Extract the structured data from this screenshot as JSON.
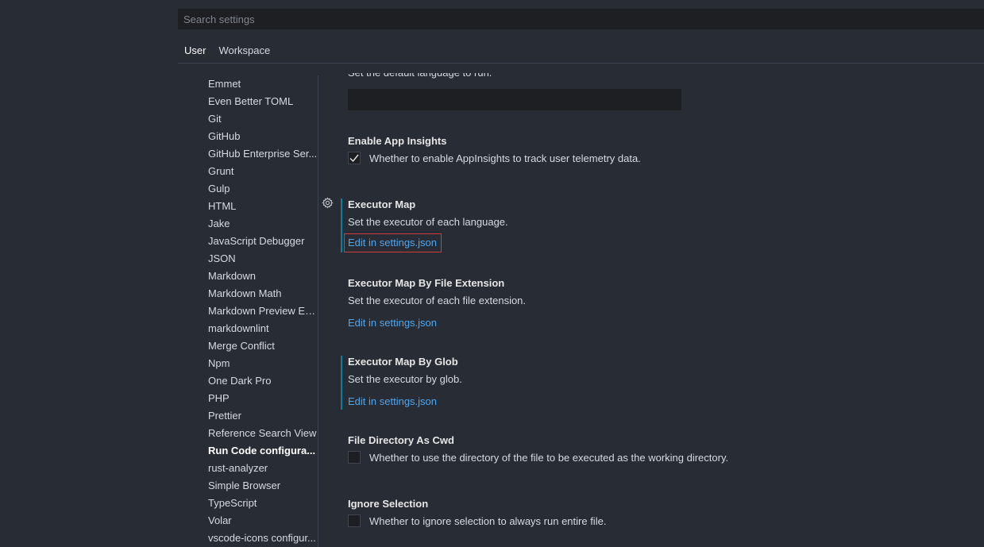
{
  "search": {
    "placeholder": "Search settings"
  },
  "tabs": [
    {
      "label": "User",
      "active": true
    },
    {
      "label": "Workspace",
      "active": false
    }
  ],
  "toc": {
    "items": [
      {
        "label": "Emmet"
      },
      {
        "label": "Even Better TOML"
      },
      {
        "label": "Git"
      },
      {
        "label": "GitHub"
      },
      {
        "label": "GitHub Enterprise Ser..."
      },
      {
        "label": "Grunt"
      },
      {
        "label": "Gulp"
      },
      {
        "label": "HTML"
      },
      {
        "label": "Jake"
      },
      {
        "label": "JavaScript Debugger"
      },
      {
        "label": "JSON"
      },
      {
        "label": "Markdown"
      },
      {
        "label": "Markdown Math"
      },
      {
        "label": "Markdown Preview En..."
      },
      {
        "label": "markdownlint"
      },
      {
        "label": "Merge Conflict"
      },
      {
        "label": "Npm"
      },
      {
        "label": "One Dark Pro"
      },
      {
        "label": "PHP"
      },
      {
        "label": "Prettier"
      },
      {
        "label": "Reference Search View"
      },
      {
        "label": "Run Code configura...",
        "active": true
      },
      {
        "label": "rust-analyzer"
      },
      {
        "label": "Simple Browser"
      },
      {
        "label": "TypeScript"
      },
      {
        "label": "Volar"
      },
      {
        "label": "vscode-icons configur..."
      }
    ]
  },
  "settings": {
    "default_language": {
      "description": "Set the default language to run.",
      "value": ""
    },
    "enable_app_insights": {
      "title": "Enable App Insights",
      "description": "Whether to enable AppInsights to track user telemetry data.",
      "checked": true
    },
    "executor_map": {
      "title": "Executor Map",
      "description": "Set the executor of each language.",
      "link": "Edit in settings.json"
    },
    "executor_map_by_file_extension": {
      "title": "Executor Map By File Extension",
      "description": "Set the executor of each file extension.",
      "link": "Edit in settings.json"
    },
    "executor_map_by_glob": {
      "title": "Executor Map By Glob",
      "description": "Set the executor by glob.",
      "link": "Edit in settings.json"
    },
    "file_directory_as_cwd": {
      "title": "File Directory As Cwd",
      "description": "Whether to use the directory of the file to be executed as the working directory.",
      "checked": false
    },
    "ignore_selection": {
      "title": "Ignore Selection",
      "description": "Whether to ignore selection to always run entire file.",
      "checked": false
    }
  },
  "icons": {
    "gear": "gear-icon",
    "check": "check-icon"
  },
  "colors": {
    "background": "#282c34",
    "input_background": "#1d1f23",
    "link": "#4fa6ed",
    "modified_indicator": "#0c7d9d",
    "focus_outline": "#d33a3a"
  }
}
